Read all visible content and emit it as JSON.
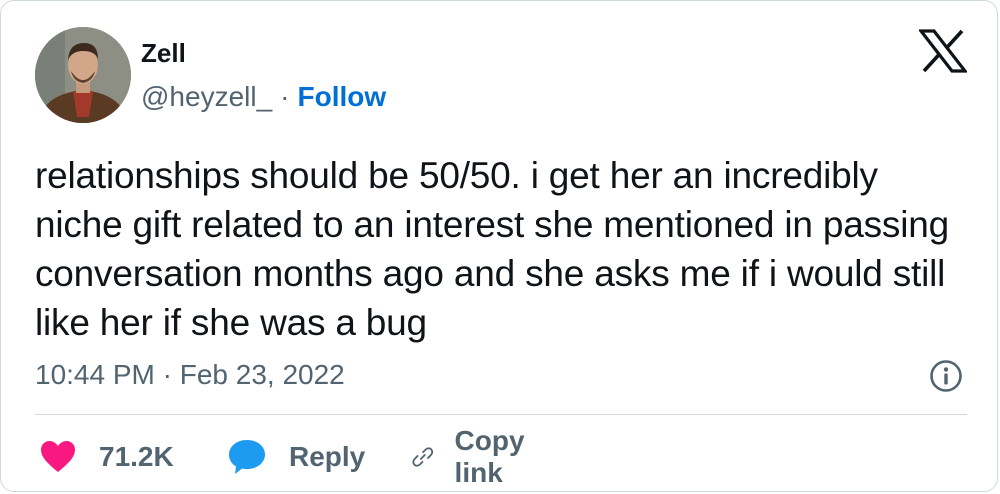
{
  "author": {
    "name": "Zell",
    "handle": "@heyzell_",
    "separator": "·",
    "follow_label": "Follow"
  },
  "tweet": {
    "text": "relationships should be 50/50. i get her an incredibly niche gift related to an interest she mentioned in passing conversation months ago and she asks me if i would still like her if she was a bug",
    "timestamp": "10:44 PM · Feb 23, 2022"
  },
  "actions": {
    "like_count": "71.2K",
    "reply_label": "Reply",
    "copy_label": "Copy link"
  },
  "icons": {
    "like": "heart-icon",
    "reply": "speech-bubble-icon",
    "copy": "link-icon",
    "info": "info-icon",
    "brand": "x-logo-icon"
  },
  "colors": {
    "like": "#f91880",
    "reply": "#1d9bf0",
    "follow": "#006fd6",
    "text": "#0f1419",
    "secondary": "#536471"
  }
}
